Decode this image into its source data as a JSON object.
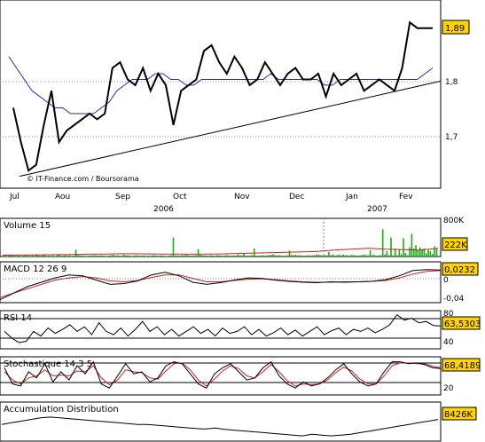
{
  "colors": {
    "price": "#000000",
    "ma": "#2a2aa8",
    "trend": "#000000",
    "volume": "#14b014",
    "volume_ma": "#cc2222",
    "signal": "#cc2222",
    "last_box": "#ffd400"
  },
  "chart_data": [
    {
      "type": "line",
      "name": "main",
      "credit": "© IT-Finance.com / Boursorama",
      "month_labels": [
        "Jul",
        "Aou",
        "Sep",
        "Oct",
        "Nov",
        "Dec",
        "Jan",
        "Fev"
      ],
      "year_labels": [
        "2006",
        "2007"
      ],
      "yticks": [
        "1,8",
        "1,7"
      ],
      "ylim": [
        1.62,
        1.93
      ],
      "last_value": "1,89",
      "series": [
        {
          "values": [
            1.75,
            1.69,
            1.64,
            1.65,
            1.72,
            1.78,
            1.69,
            1.71,
            1.72,
            1.73,
            1.74,
            1.73,
            1.74,
            1.82,
            1.83,
            1.8,
            1.79,
            1.82,
            1.78,
            1.81,
            1.79,
            1.72,
            1.78,
            1.79,
            1.8,
            1.85,
            1.86,
            1.83,
            1.81,
            1.84,
            1.82,
            1.79,
            1.8,
            1.83,
            1.81,
            1.79,
            1.81,
            1.82,
            1.8,
            1.8,
            1.81,
            1.77,
            1.81,
            1.79,
            1.8,
            1.81,
            1.78,
            1.79,
            1.8,
            1.79,
            1.78,
            1.82,
            1.9,
            1.89,
            1.89,
            1.89
          ]
        },
        {
          "values": [
            1.84,
            1.82,
            1.8,
            1.78,
            1.77,
            1.76,
            1.75,
            1.75,
            1.74,
            1.74,
            1.74,
            1.74,
            1.75,
            1.76,
            1.78,
            1.79,
            1.8,
            1.8,
            1.8,
            1.81,
            1.81,
            1.8,
            1.8,
            1.79,
            1.79,
            1.8,
            1.8,
            1.8,
            1.8,
            1.8,
            1.8,
            1.8,
            1.8,
            1.8,
            1.81,
            1.8,
            1.8,
            1.8,
            1.8,
            1.8,
            1.8,
            1.79,
            1.79,
            1.8,
            1.8,
            1.8,
            1.8,
            1.8,
            1.8,
            1.8,
            1.8,
            1.8,
            1.8,
            1.8,
            1.81,
            1.82
          ]
        },
        {
          "values": [
            1.63,
            1.797
          ]
        }
      ]
    },
    {
      "type": "bar",
      "name": "Volume 15",
      "yticks": [
        "800K"
      ],
      "ylim": [
        0,
        800
      ],
      "last_value": "222K",
      "values": [
        15,
        25,
        10,
        20,
        30,
        18,
        12,
        22,
        15,
        10,
        20,
        30,
        15,
        10,
        20,
        10,
        50,
        20,
        15,
        25,
        30,
        10,
        20,
        15,
        25,
        10,
        30,
        40,
        15,
        20,
        30,
        15,
        25,
        10,
        20,
        150,
        30,
        25,
        20,
        15,
        10,
        20,
        15,
        25,
        30,
        20,
        15,
        25,
        20,
        15,
        10,
        20,
        30,
        40,
        15,
        25,
        20,
        15,
        45,
        30,
        25,
        20,
        10,
        20,
        30,
        25,
        15,
        20,
        25,
        10,
        20,
        15,
        25,
        30,
        20,
        15,
        25,
        20,
        15,
        10,
        20,
        30,
        420,
        25,
        20,
        15,
        30,
        25,
        50,
        30,
        20,
        15,
        20,
        30,
        160,
        40,
        30,
        25,
        20,
        15,
        25,
        20,
        15,
        30,
        25,
        20,
        15,
        25,
        30,
        20,
        15,
        25,
        20,
        40,
        30,
        25,
        60,
        20,
        15,
        25,
        30,
        180,
        20,
        15,
        25,
        30,
        20,
        25,
        30,
        40,
        50,
        30,
        25,
        30,
        20,
        20,
        15,
        25,
        130,
        35,
        30,
        40,
        25,
        30,
        20,
        15,
        25,
        30,
        20,
        25,
        30,
        40,
        45,
        30,
        20,
        25,
        30,
        100,
        30,
        45,
        20,
        30,
        35,
        25,
        40,
        30,
        25,
        20,
        35,
        30,
        25,
        20,
        25,
        30,
        45,
        30,
        25,
        140,
        30,
        35,
        20,
        25,
        30,
        600,
        40,
        120,
        30,
        420,
        25,
        180,
        30,
        150,
        50,
        400,
        80,
        30,
        200,
        500,
        180,
        250,
        150,
        200,
        160,
        180,
        70,
        140,
        120,
        60,
        220,
        180
      ],
      "ma_values": [
        30,
        32,
        35,
        40,
        45,
        50,
        55,
        60,
        58,
        55,
        52,
        50,
        55,
        60,
        70,
        80,
        90,
        100,
        110,
        140,
        160,
        180,
        160,
        150,
        140,
        180
      ]
    },
    {
      "type": "line",
      "name": "MACD 12 26 9",
      "yticks": [
        "0",
        "-0,04"
      ],
      "ylim": [
        -0.05,
        0.04
      ],
      "last_value": "0,0232",
      "series": [
        {
          "values": [
            -0.045,
            -0.03,
            -0.015,
            -0.005,
            0.005,
            0.012,
            0.01,
            0.0,
            -0.01,
            -0.008,
            -0.002,
            0.012,
            0.018,
            0.01,
            -0.005,
            -0.01,
            -0.006,
            0.0,
            0.005,
            0.004,
            0.0,
            -0.003,
            -0.005,
            -0.006,
            -0.004,
            -0.005,
            -0.004,
            -0.003,
            0.001,
            0.01,
            0.022,
            0.024,
            0.023
          ]
        },
        {
          "values": [
            -0.04,
            -0.03,
            -0.02,
            -0.01,
            0.0,
            0.005,
            0.008,
            0.005,
            -0.002,
            -0.004,
            -0.001,
            0.006,
            0.012,
            0.012,
            0.004,
            -0.004,
            -0.004,
            -0.001,
            0.002,
            0.003,
            0.001,
            -0.002,
            -0.004,
            -0.005,
            -0.005,
            -0.004,
            -0.004,
            -0.003,
            -0.001,
            0.005,
            0.014,
            0.02,
            0.022
          ]
        }
      ]
    },
    {
      "type": "line",
      "name": "RSI 14",
      "yticks": [
        "80",
        "40"
      ],
      "ylim": [
        30,
        85
      ],
      "last_value": "63,5303",
      "series": [
        {
          "values": [
            55,
            45,
            38,
            40,
            55,
            48,
            60,
            52,
            58,
            65,
            55,
            62,
            50,
            68,
            55,
            50,
            60,
            48,
            58,
            70,
            55,
            62,
            50,
            58,
            48,
            55,
            62,
            52,
            58,
            48,
            60,
            52,
            55,
            62,
            50,
            58,
            48,
            53,
            60,
            50,
            57,
            48,
            55,
            62,
            50,
            56,
            60,
            50,
            58,
            55,
            60,
            53,
            58,
            65,
            80,
            72,
            75,
            68,
            70,
            64,
            63
          ]
        }
      ]
    },
    {
      "type": "line",
      "name": "Stochastique 14 3 5",
      "yticks": [
        "20"
      ],
      "ylim": [
        5,
        95
      ],
      "last_value": "68,4189",
      "series": [
        {
          "values": [
            70,
            30,
            25,
            60,
            45,
            80,
            35,
            60,
            40,
            75,
            55,
            85,
            30,
            20,
            50,
            80,
            55,
            60,
            35,
            45,
            75,
            85,
            80,
            55,
            30,
            20,
            55,
            70,
            80,
            60,
            40,
            45,
            70,
            85,
            50,
            30,
            20,
            35,
            25,
            30,
            45,
            65,
            80,
            55,
            35,
            25,
            30,
            60,
            85,
            85,
            80,
            82,
            78,
            70,
            68
          ]
        },
        {
          "values": [
            60,
            40,
            30,
            45,
            50,
            65,
            50,
            52,
            50,
            62,
            60,
            75,
            45,
            28,
            40,
            65,
            60,
            58,
            45,
            42,
            62,
            80,
            82,
            65,
            40,
            25,
            42,
            62,
            75,
            68,
            50,
            45,
            60,
            78,
            60,
            38,
            25,
            30,
            28,
            30,
            40,
            58,
            72,
            62,
            42,
            30,
            30,
            50,
            75,
            82,
            82,
            80,
            80,
            74,
            70
          ]
        }
      ]
    },
    {
      "type": "line",
      "name": "Accumulation Distribution",
      "last_value": "8426K",
      "series": [
        {
          "values": [
            5,
            6,
            7,
            8,
            9,
            9.5,
            9,
            8.5,
            8,
            7.5,
            7,
            6.5,
            6,
            5.5,
            5,
            5,
            4.5,
            4,
            3.5,
            3,
            2.5,
            2.2,
            2.8,
            2,
            1.5,
            1,
            0.5,
            0,
            -0.5,
            -1,
            -1.5,
            -2,
            -1,
            -1.5,
            -2,
            -1.5,
            -1,
            0,
            1,
            2,
            3,
            4,
            5,
            6,
            7,
            8
          ]
        }
      ]
    }
  ]
}
